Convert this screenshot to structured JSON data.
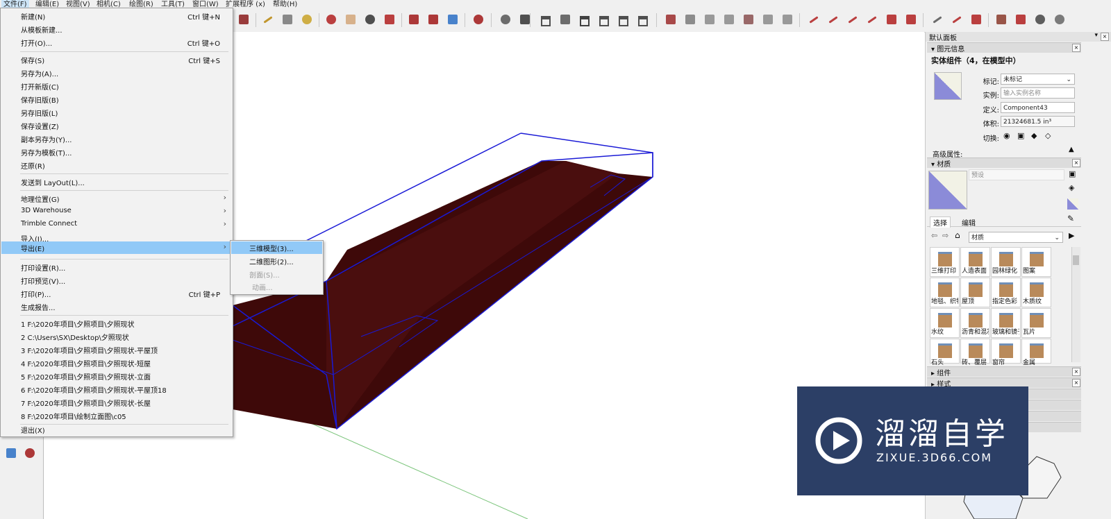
{
  "menubar": {
    "items": [
      "文件(F)",
      "编辑(E)",
      "视图(V)",
      "相机(C)",
      "绘图(R)",
      "工具(T)",
      "窗口(W)",
      "扩展程序 (x)",
      "帮助(H)"
    ]
  },
  "file_menu": {
    "items": [
      {
        "label": "新建(N)",
        "shortcut": "Ctrl 键+N"
      },
      {
        "label": "从模板新建..."
      },
      {
        "label": "打开(O)...",
        "shortcut": "Ctrl 键+O"
      },
      {
        "label": "保存(S)",
        "shortcut": "Ctrl 键+S"
      },
      {
        "label": "另存为(A)..."
      },
      {
        "label": "打开新版(C)"
      },
      {
        "label": "保存旧版(B)"
      },
      {
        "label": "另存旧版(L)"
      },
      {
        "label": "保存设置(Z)"
      },
      {
        "label": "副本另存为(Y)..."
      },
      {
        "label": "另存为模板(T)..."
      },
      {
        "label": "还原(R)"
      },
      {
        "label": "发送到 LayOut(L)..."
      },
      {
        "label": "地理位置(G)"
      },
      {
        "label": "3D Warehouse"
      },
      {
        "label": "Trimble Connect"
      },
      {
        "label": "导入(I)..."
      },
      {
        "label": "导出(E)"
      },
      {
        "label": "打印设置(R)..."
      },
      {
        "label": "打印预览(V)..."
      },
      {
        "label": "打印(P)...",
        "shortcut": "Ctrl 键+P"
      },
      {
        "label": "生成报告..."
      },
      {
        "label": "1 F:\\2020年项目\\夕照项目\\夕照现状"
      },
      {
        "label": "2 C:\\Users\\SX\\Desktop\\夕照现状"
      },
      {
        "label": "3 F:\\2020年项目\\夕照项目\\夕照现状-平屋顶"
      },
      {
        "label": "4 F:\\2020年项目\\夕照项目\\夕照现状-短屋"
      },
      {
        "label": "5 F:\\2020年项目\\夕照项目\\夕照现状-立面"
      },
      {
        "label": "6 F:\\2020年项目\\夕照项目\\夕照现状-平屋顶18"
      },
      {
        "label": "7 F:\\2020年项目\\夕照项目\\夕照现状-长屋"
      },
      {
        "label": "8 F:\\2020年项目\\绘制立面图\\c05"
      },
      {
        "label": "退出(X)"
      }
    ]
  },
  "export_submenu": {
    "items": [
      {
        "label": "三维模型(3)..."
      },
      {
        "label": "二维图形(2)..."
      },
      {
        "label": "剖面(S)..."
      },
      {
        "label": "动画..."
      }
    ]
  },
  "tray": {
    "title": "默认面板",
    "entity_info": {
      "header": "图元信息",
      "entity_title": "实体组件（4，在模型中）",
      "tag_label": "标记:",
      "tag_value": "未标记",
      "instance_label": "实例:",
      "instance_placeholder": "输入实例名称",
      "definition_label": "定义:",
      "definition_value": "Component43",
      "volume_label": "体积:",
      "volume_value": "21324681.5 in³",
      "toggle_label": "切换:",
      "advanced_label": "高级属性:"
    },
    "materials": {
      "header": "材质",
      "preset_placeholder": "预设",
      "tab_select": "选择",
      "tab_edit": "编辑",
      "library_value": "材质",
      "items": [
        "三维打印",
        "人造表面",
        "园林绿化",
        "图案",
        "地毯、织物",
        "屋顶",
        "指定色彩",
        "木质纹",
        "水纹",
        "沥青和混凝土",
        "玻璃和镜子",
        "瓦片",
        "石头",
        "砖、覆层",
        "窗帘",
        "金属"
      ]
    },
    "collapsed_panels": [
      "组件",
      "样式"
    ]
  },
  "watermark": {
    "brand_cn": "溜溜自学",
    "brand_url": "ZIXUE.3D66.COM"
  },
  "colors": {
    "menu_highlight": "#91c9f7",
    "model_face": "#3e0909",
    "model_edge": "#1a1ad6",
    "watermark_bg": "#2c3f66"
  }
}
